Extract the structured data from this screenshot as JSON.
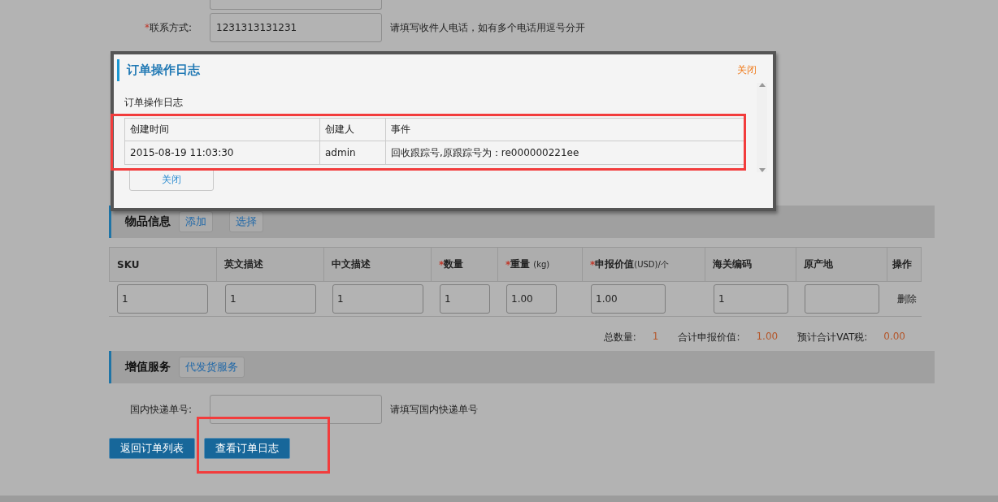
{
  "contact": {
    "required_mark": "*",
    "label": "联系方式:",
    "value": "1231313131231",
    "hint": "请填写收件人电话，如有多个电话用逗号分开"
  },
  "items_section": {
    "title": "物品信息",
    "buttons": [
      "添加",
      "选择"
    ]
  },
  "items_table": {
    "columns": [
      {
        "label": "SKU"
      },
      {
        "label": "英文描述"
      },
      {
        "label": "中文描述"
      },
      {
        "label": "数量",
        "required_mark": "*"
      },
      {
        "label": "重量",
        "required_mark": "*",
        "unit": "(kg)"
      },
      {
        "label": "申报价值",
        "required_mark": "*",
        "unit": "(USD)/个"
      },
      {
        "label": "海关编码"
      },
      {
        "label": "原产地"
      },
      {
        "label": "操作"
      }
    ],
    "rows": [
      {
        "cells": [
          "1",
          "1",
          "1",
          "1",
          "1.00",
          "1.00",
          "1"
        ],
        "action": "删除"
      }
    ]
  },
  "totals": [
    {
      "label": "总数量:",
      "value": "1"
    },
    {
      "label": "合计申报价值:",
      "value": "1.00"
    },
    {
      "label": "预计合计VAT税:",
      "value": "0.00"
    }
  ],
  "value_added_section": {
    "title": "增值服务",
    "buttons": [
      "代发货服务"
    ]
  },
  "domestic_tracking": {
    "label": "国内快递单号:",
    "hint": "请填写国内快递单号"
  },
  "actions": [
    "返回订单列表",
    "查看订单日志"
  ],
  "modal": {
    "title": "订单操作日志",
    "close_link": "关闭",
    "subtitle": "订单操作日志",
    "columns": [
      "创建时间",
      "创建人",
      "事件"
    ],
    "rows": [
      [
        "2015-08-19 11:03:30",
        "admin",
        "回收跟踪号,原跟踪号为：re000000221ee"
      ]
    ],
    "close_button": "关闭"
  }
}
